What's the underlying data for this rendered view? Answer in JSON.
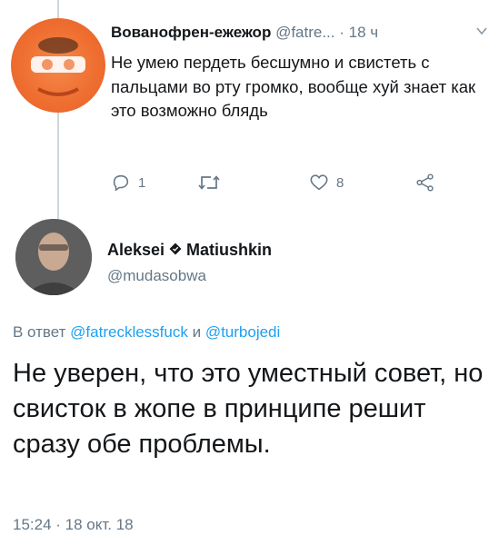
{
  "tweet1": {
    "display_name": "Вованофрен-ежежор",
    "handle": "@fatre...",
    "separator": " · ",
    "time": "18 ч",
    "text": "Не умею пердеть бесшумно и свистеть с пальцами во рту громко, вообще хуй знает как это возможно блядь",
    "actions": {
      "reply_count": "1",
      "retweet_count": "",
      "like_count": "8"
    }
  },
  "tweet2": {
    "first_name": "Aleksei",
    "last_name": "Matiushkin",
    "handle": "@mudasobwa",
    "reply_prefix": "В ответ ",
    "reply_user1": "@fatrecklessfuck",
    "reply_joiner": " и ",
    "reply_user2": "@turbojedi",
    "text": "Не уверен, что это уместный совет, но свисток в жопе в принципе решит сразу обе проблемы.",
    "timestamp": "15:24 · 18 окт. 18"
  },
  "icons": {
    "reply": "reply-icon",
    "retweet": "retweet-icon",
    "like": "heart-icon",
    "share": "share-icon",
    "caret": "chevron-down-icon",
    "verified": "diamond-icon"
  },
  "colors": {
    "link": "#1da1f2",
    "muted": "#657786",
    "avatar1": "#ee6d2f"
  }
}
